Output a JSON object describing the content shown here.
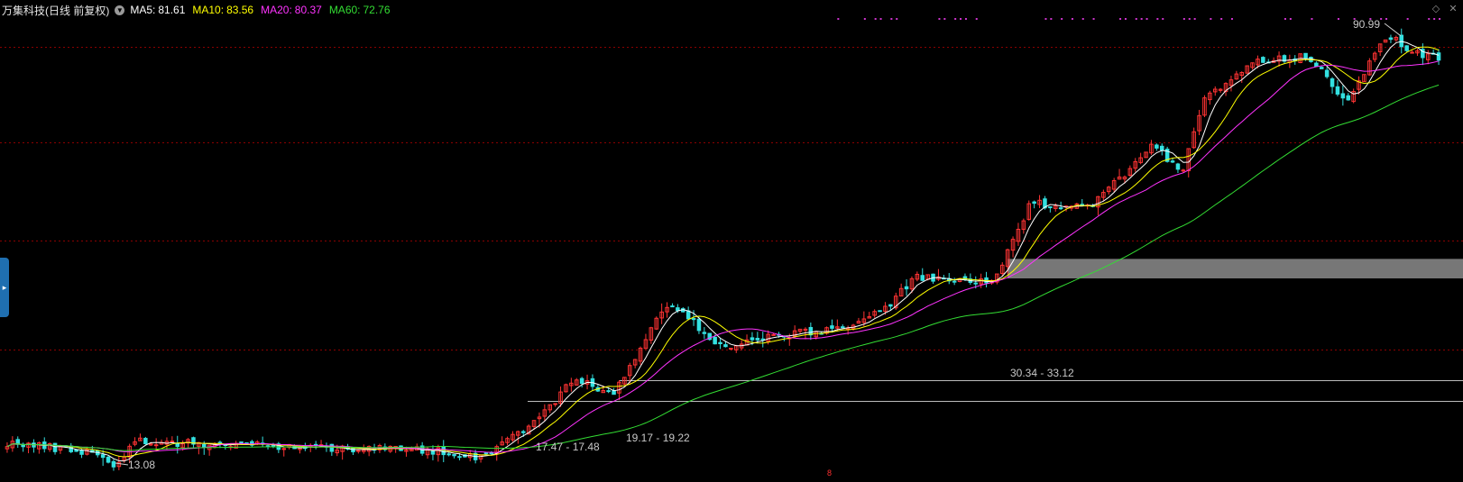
{
  "header": {
    "title": "万集科技(日线 前复权)",
    "indicators": [
      {
        "label": "MA5:",
        "value": "81.61",
        "color": "#ffffff"
      },
      {
        "label": "MA10:",
        "value": "83.56",
        "color": "#ffff00"
      },
      {
        "label": "MA20:",
        "value": "80.37",
        "color": "#ff33ff"
      },
      {
        "label": "MA60:",
        "value": "72.76",
        "color": "#33dd33"
      }
    ]
  },
  "annotations": {
    "high": "90.99",
    "low": "13.08",
    "zone1": "17.47 - 17.48",
    "zone2": "19.17 - 19.22",
    "zone3": "30.34 - 33.12"
  },
  "separator_mark": "8",
  "colors": {
    "background": "#000000",
    "up_candle": "#ff3333",
    "down_candle": "#33e0e0",
    "grid": "#8b0000",
    "signal_dots": "#cc33cc",
    "zone_band": "#8c8c8c"
  },
  "icons": {
    "side_tab": "expand-panel-icon",
    "top_right_1": "diamond-icon",
    "top_right_2": "close-icon"
  },
  "chart_data": {
    "type": "candlestick",
    "y_scale": "log",
    "ylim": [
      12.5,
      97
    ],
    "title": "万集科技(日线 前复权)",
    "price_anchors": [
      {
        "x": 0,
        "p": 14.5
      },
      {
        "x": 0.06,
        "p": 13.9
      },
      {
        "x": 0.075,
        "p": 13.1
      },
      {
        "x": 0.09,
        "p": 14.6
      },
      {
        "x": 0.18,
        "p": 14.3
      },
      {
        "x": 0.3,
        "p": 14.0
      },
      {
        "x": 0.33,
        "p": 13.6
      },
      {
        "x": 0.37,
        "p": 16.0
      },
      {
        "x": 0.395,
        "p": 19.2
      },
      {
        "x": 0.425,
        "p": 18.2
      },
      {
        "x": 0.46,
        "p": 27.0
      },
      {
        "x": 0.47,
        "p": 26.2
      },
      {
        "x": 0.5,
        "p": 22.2
      },
      {
        "x": 0.535,
        "p": 23.4
      },
      {
        "x": 0.58,
        "p": 24.2
      },
      {
        "x": 0.61,
        "p": 26.0
      },
      {
        "x": 0.635,
        "p": 30.5
      },
      {
        "x": 0.66,
        "p": 30.0
      },
      {
        "x": 0.69,
        "p": 30.0
      },
      {
        "x": 0.715,
        "p": 42.5
      },
      {
        "x": 0.755,
        "p": 42.0
      },
      {
        "x": 0.785,
        "p": 49.5
      },
      {
        "x": 0.8,
        "p": 56.5
      },
      {
        "x": 0.82,
        "p": 48.0
      },
      {
        "x": 0.835,
        "p": 67.0
      },
      {
        "x": 0.87,
        "p": 80.0
      },
      {
        "x": 0.905,
        "p": 82.0
      },
      {
        "x": 0.92,
        "p": 77.0
      },
      {
        "x": 0.935,
        "p": 67.0
      },
      {
        "x": 0.955,
        "p": 82.0
      },
      {
        "x": 0.965,
        "p": 91.0
      },
      {
        "x": 0.985,
        "p": 83.0
      },
      {
        "x": 1.0,
        "p": 81.6
      }
    ],
    "moving_averages": [
      {
        "name": "MA5",
        "period": 5,
        "value": 81.61,
        "color": "#ffffff"
      },
      {
        "name": "MA10",
        "period": 10,
        "value": 83.56,
        "color": "#ffff00"
      },
      {
        "name": "MA20",
        "period": 20,
        "value": 80.37,
        "color": "#ff33ff"
      },
      {
        "name": "MA60",
        "period": 60,
        "value": 72.76,
        "color": "#33dd33"
      }
    ],
    "grid_prices": [
      22,
      36,
      56,
      86
    ],
    "price_levels": [
      {
        "label": "17.47 - 17.48",
        "low": 17.47,
        "high": 17.48
      },
      {
        "label": "19.17 - 19.22",
        "low": 19.17,
        "high": 19.22
      },
      {
        "label": "30.34 - 33.12",
        "low": 30.34,
        "high": 33.12
      }
    ],
    "high_marker": {
      "label": "90.99",
      "value": 90.99
    },
    "low_marker": {
      "label": "13.08",
      "value": 13.08
    }
  }
}
